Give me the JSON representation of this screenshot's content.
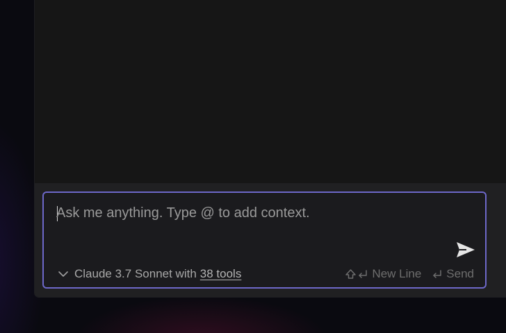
{
  "composer": {
    "placeholder": "Ask me anything. Type @ to add context.",
    "value": "",
    "send_icon": "send-icon",
    "accent_color": "#6d68c9"
  },
  "model": {
    "chevron_icon": "chevron-down-icon",
    "label": "Claude 3.7 Sonnet with",
    "tools_link": "38 tools"
  },
  "hints": {
    "new_line": {
      "icons": [
        "shift-icon",
        "return-icon"
      ],
      "label": "New Line"
    },
    "send": {
      "icons": [
        "return-icon"
      ],
      "label": "Send"
    }
  }
}
